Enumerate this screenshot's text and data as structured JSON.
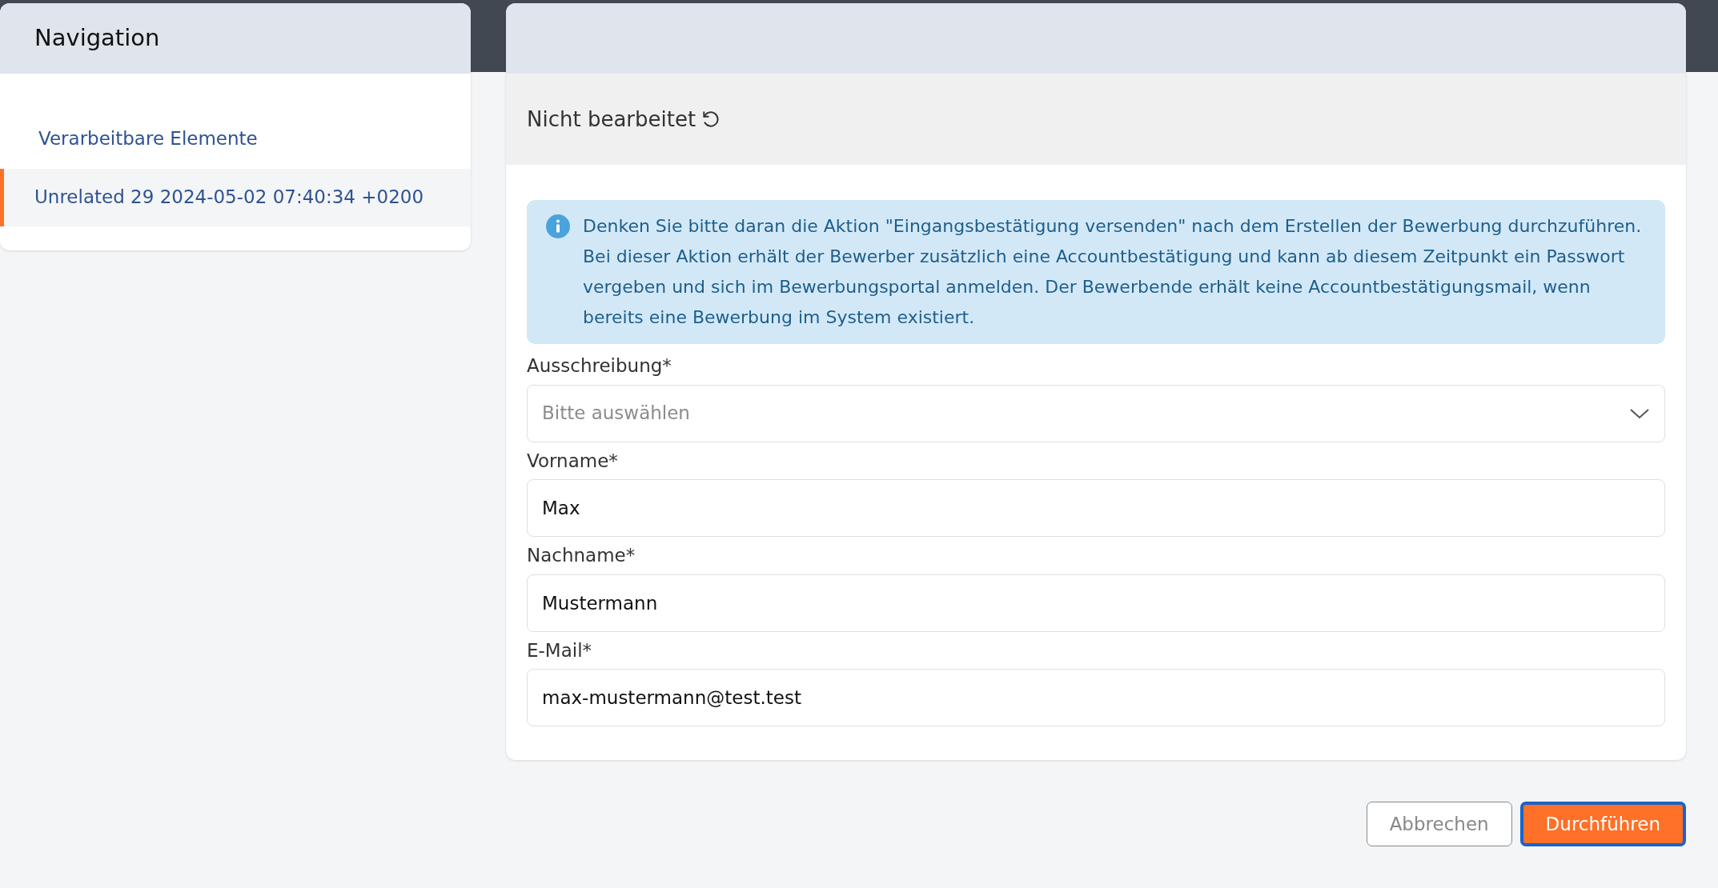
{
  "navigation": {
    "title": "Navigation",
    "items": [
      {
        "label": "Verarbeitbare Elemente",
        "selected": false
      },
      {
        "label": "Unrelated 29 2024-05-02 07:40:34 +0200",
        "selected": true
      }
    ]
  },
  "panel": {
    "status": "Nicht bearbeitet",
    "alert": "Denken Sie bitte daran die Aktion \"Eingangsbestätigung versenden\" nach dem Erstellen der Bewerbung durchzuführen. Bei dieser Aktion erhält der Bewerber zusätzlich eine Accountbestätigung und kann ab diesem Zeitpunkt ein Passwort vergeben und sich im Bewerbungsportal anmelden. Der Bewerbende erhält keine Accountbestätigungsmail, wenn bereits eine Bewerbung im System existiert.",
    "fields": [
      {
        "kind": "select",
        "label": "Ausschreibung*",
        "placeholder": "Bitte auswählen"
      },
      {
        "kind": "text",
        "label": "Vorname*",
        "value": "Max"
      },
      {
        "kind": "text",
        "label": "Nachname*",
        "value": "Mustermann"
      },
      {
        "kind": "text",
        "label": "E-Mail*",
        "value": "max-mustermann@test.test"
      }
    ]
  },
  "buttons": [
    {
      "kind": "secondary",
      "label": "Abbrechen",
      "focused": false
    },
    {
      "kind": "primary",
      "label": "Durchführen",
      "focused": true
    }
  ]
}
